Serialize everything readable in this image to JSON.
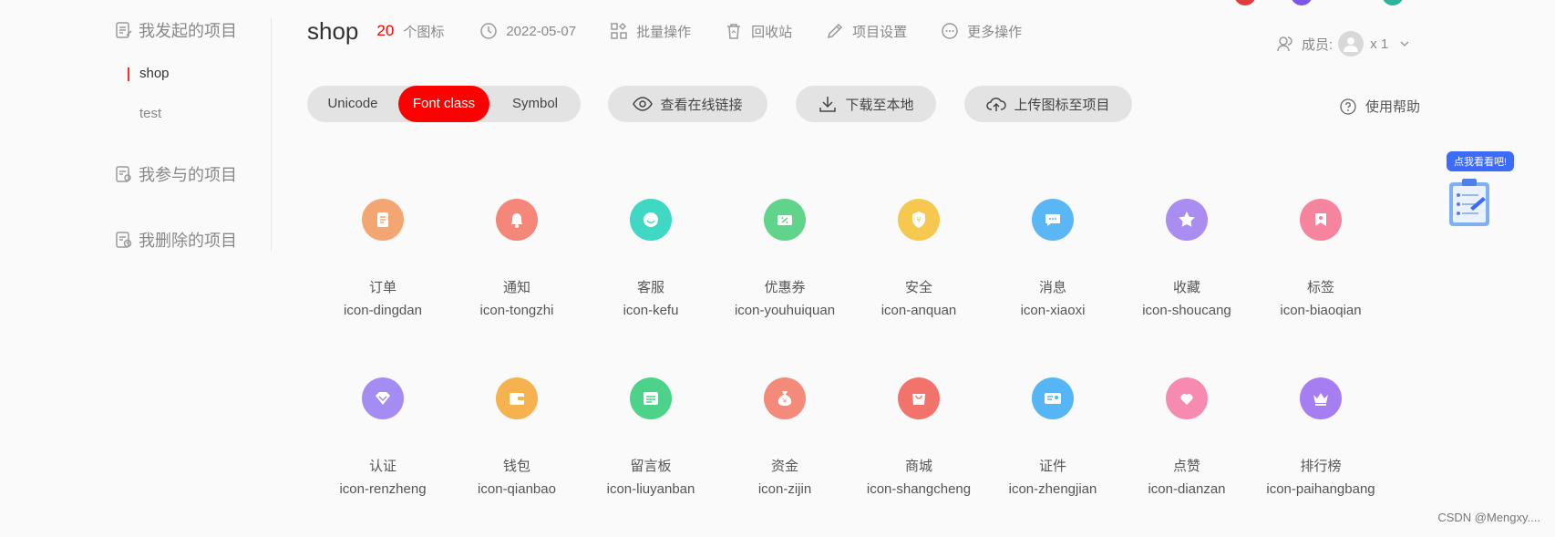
{
  "decor_colors": [
    "#e23b3b",
    "#7a55e6",
    "#2eb39c"
  ],
  "sidebar": {
    "groups": [
      {
        "label": "我发起的项目",
        "icon": "project-list-icon"
      },
      {
        "label": "我参与的项目",
        "icon": "project-join-icon"
      },
      {
        "label": "我删除的项目",
        "icon": "project-deleted-icon"
      }
    ],
    "projects": [
      {
        "label": "shop",
        "active": true
      },
      {
        "label": "test",
        "active": false
      }
    ]
  },
  "header": {
    "project_name": "shop",
    "icon_count": "20",
    "icon_count_label": "个图标",
    "date": "2022-05-07",
    "batch_label": "批量操作",
    "recycle_label": "回收站",
    "settings_label": "项目设置",
    "more_label": "更多操作",
    "members_label": "成员:",
    "members_count": "x 1"
  },
  "toolbar": {
    "tabs": [
      {
        "label": "Unicode",
        "active": false
      },
      {
        "label": "Font class",
        "active": true
      },
      {
        "label": "Symbol",
        "active": false
      }
    ],
    "view_link_label": "查看在线链接",
    "download_label": "下载至本地",
    "upload_label": "上传图标至项目",
    "help_label": "使用帮助"
  },
  "icons": [
    {
      "name": "订单",
      "code": "icon-dingdan",
      "color": "#f4a672",
      "glyph": "order"
    },
    {
      "name": "通知",
      "code": "icon-tongzhi",
      "color": "#f4877a",
      "glyph": "bell"
    },
    {
      "name": "客服",
      "code": "icon-kefu",
      "color": "#3fd8c4",
      "glyph": "chat-bubble"
    },
    {
      "name": "优惠券",
      "code": "icon-youhuiquan",
      "color": "#5fd48a",
      "glyph": "coupon"
    },
    {
      "name": "安全",
      "code": "icon-anquan",
      "color": "#f7c84f",
      "glyph": "shield"
    },
    {
      "name": "消息",
      "code": "icon-xiaoxi",
      "color": "#5ab6f5",
      "glyph": "message"
    },
    {
      "name": "收藏",
      "code": "icon-shoucang",
      "color": "#a98df0",
      "glyph": "star"
    },
    {
      "name": "标签",
      "code": "icon-biaoqian",
      "color": "#f6849e",
      "glyph": "tag"
    },
    {
      "name": "认证",
      "code": "icon-renzheng",
      "color": "#a48cf2",
      "glyph": "diamond"
    },
    {
      "name": "钱包",
      "code": "icon-qianbao",
      "color": "#f5b24e",
      "glyph": "wallet"
    },
    {
      "name": "留言板",
      "code": "icon-liuyanban",
      "color": "#4dd389",
      "glyph": "board"
    },
    {
      "name": "资金",
      "code": "icon-zijin",
      "color": "#f48a7a",
      "glyph": "money-bag"
    },
    {
      "name": "商城",
      "code": "icon-shangcheng",
      "color": "#f2736c",
      "glyph": "shop-bag"
    },
    {
      "name": "证件",
      "code": "icon-zhengjian",
      "color": "#55b5f5",
      "glyph": "id-card"
    },
    {
      "name": "点赞",
      "code": "icon-dianzan",
      "color": "#f68ab0",
      "glyph": "heart"
    },
    {
      "name": "排行榜",
      "code": "icon-paihangbang",
      "color": "#a77ef2",
      "glyph": "crown"
    }
  ],
  "widget": {
    "label": "点我看看吧!"
  },
  "watermark": "CSDN @Mengxy...."
}
